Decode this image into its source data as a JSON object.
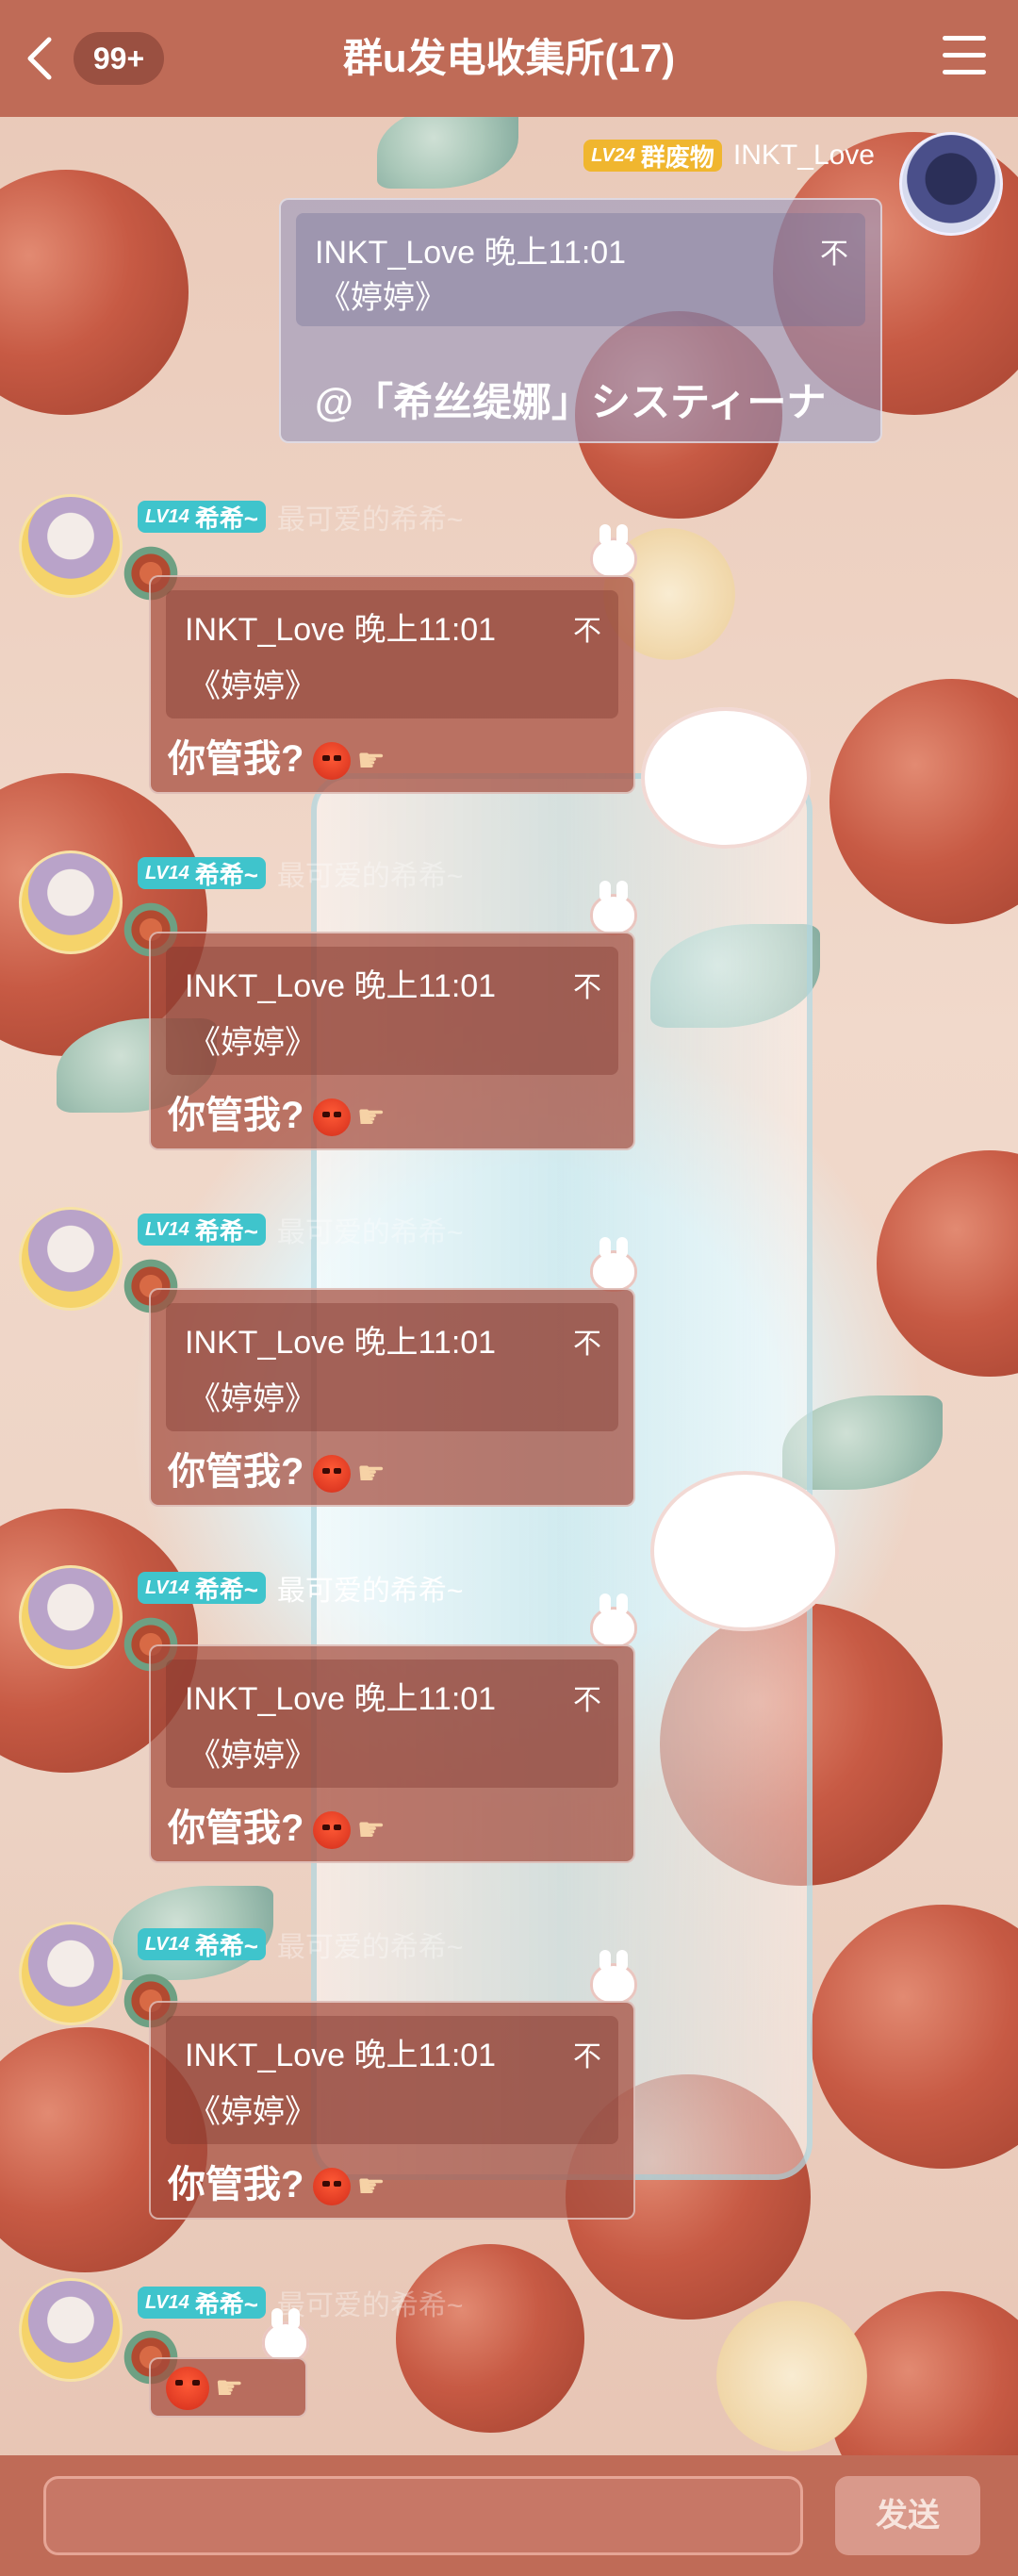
{
  "header": {
    "back_icon": "chevron-left-icon",
    "unread_badge": "99+",
    "title": "群u发电收集所(17)",
    "menu_icon": "hamburger-menu-icon"
  },
  "sender_self": {
    "level": "LV24",
    "group_title": "群废物",
    "name": "INKT_Love",
    "quote_name_time": "INKT_Love 晚上11:01",
    "quote_text": "《婷婷》",
    "quote_close": "不",
    "message": "@「希丝缇娜」システィーナ"
  },
  "messages": [
    {
      "level": "LV14",
      "group_title": "希希~",
      "name": "最可爱的希希~",
      "quote_name_time": "INKT_Love 晚上11:01",
      "quote_text": "《婷婷》",
      "quote_close": "不",
      "reply_text": "你管我?"
    },
    {
      "level": "LV14",
      "group_title": "希希~",
      "name": "最可爱的希希~",
      "quote_name_time": "INKT_Love 晚上11:01",
      "quote_text": "《婷婷》",
      "quote_close": "不",
      "reply_text": "你管我?"
    },
    {
      "level": "LV14",
      "group_title": "希希~",
      "name": "最可爱的希希~",
      "quote_name_time": "INKT_Love 晚上11:01",
      "quote_text": "《婷婷》",
      "quote_close": "不",
      "reply_text": "你管我?"
    },
    {
      "level": "LV14",
      "group_title": "希希~",
      "name": "最可爱的希希~",
      "quote_name_time": "INKT_Love 晚上11:01",
      "quote_text": "《婷婷》",
      "quote_close": "不",
      "reply_text": "你管我?"
    },
    {
      "level": "LV14",
      "group_title": "希希~",
      "name": "最可爱的希希~",
      "quote_name_time": "INKT_Love 晚上11:01",
      "quote_text": "《婷婷》",
      "quote_close": "不",
      "reply_text": "你管我?"
    },
    {
      "level": "LV14",
      "group_title": "希希~",
      "name": "最可爱的希希~",
      "emoji_only": true
    }
  ],
  "footer": {
    "input_placeholder": "",
    "send_label": "发送"
  },
  "colors": {
    "bar": "#bf6b57",
    "bubble": "#a54b3c",
    "level_teal": "#3fc4cc",
    "level_gold": "#f0b62f"
  }
}
